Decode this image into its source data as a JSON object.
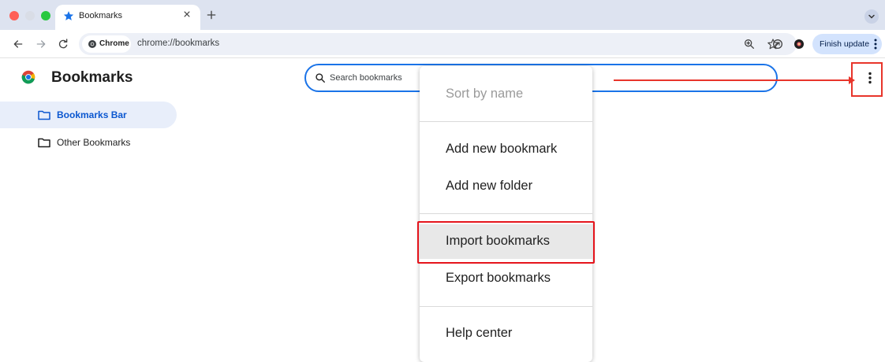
{
  "tab": {
    "title": "Bookmarks",
    "close_glyph": "×",
    "new_tab_glyph": "+",
    "icon": "star-icon"
  },
  "toolbar": {
    "chip_label": "Chrome",
    "url": "chrome://bookmarks",
    "finish_update_label": "Finish update"
  },
  "page": {
    "title": "Bookmarks",
    "search_placeholder": "Search bookmarks"
  },
  "sidebar": {
    "items": [
      {
        "label": "Bookmarks Bar",
        "active": true,
        "icon": "folder-icon"
      },
      {
        "label": "Other Bookmarks",
        "active": false,
        "icon": "folder-icon"
      }
    ]
  },
  "menu": {
    "items": [
      {
        "label": "Sort by name",
        "disabled": true
      },
      {
        "label": "Add new bookmark"
      },
      {
        "label": "Add new folder"
      },
      {
        "label": "Import bookmarks",
        "highlighted": true
      },
      {
        "label": "Export bookmarks"
      },
      {
        "label": "Help center"
      }
    ]
  },
  "colors": {
    "accent": "#1a73e8",
    "annotation_red": "#e8352b",
    "active_item_bg": "#e8eefa",
    "active_item_text": "#0b57d0"
  }
}
